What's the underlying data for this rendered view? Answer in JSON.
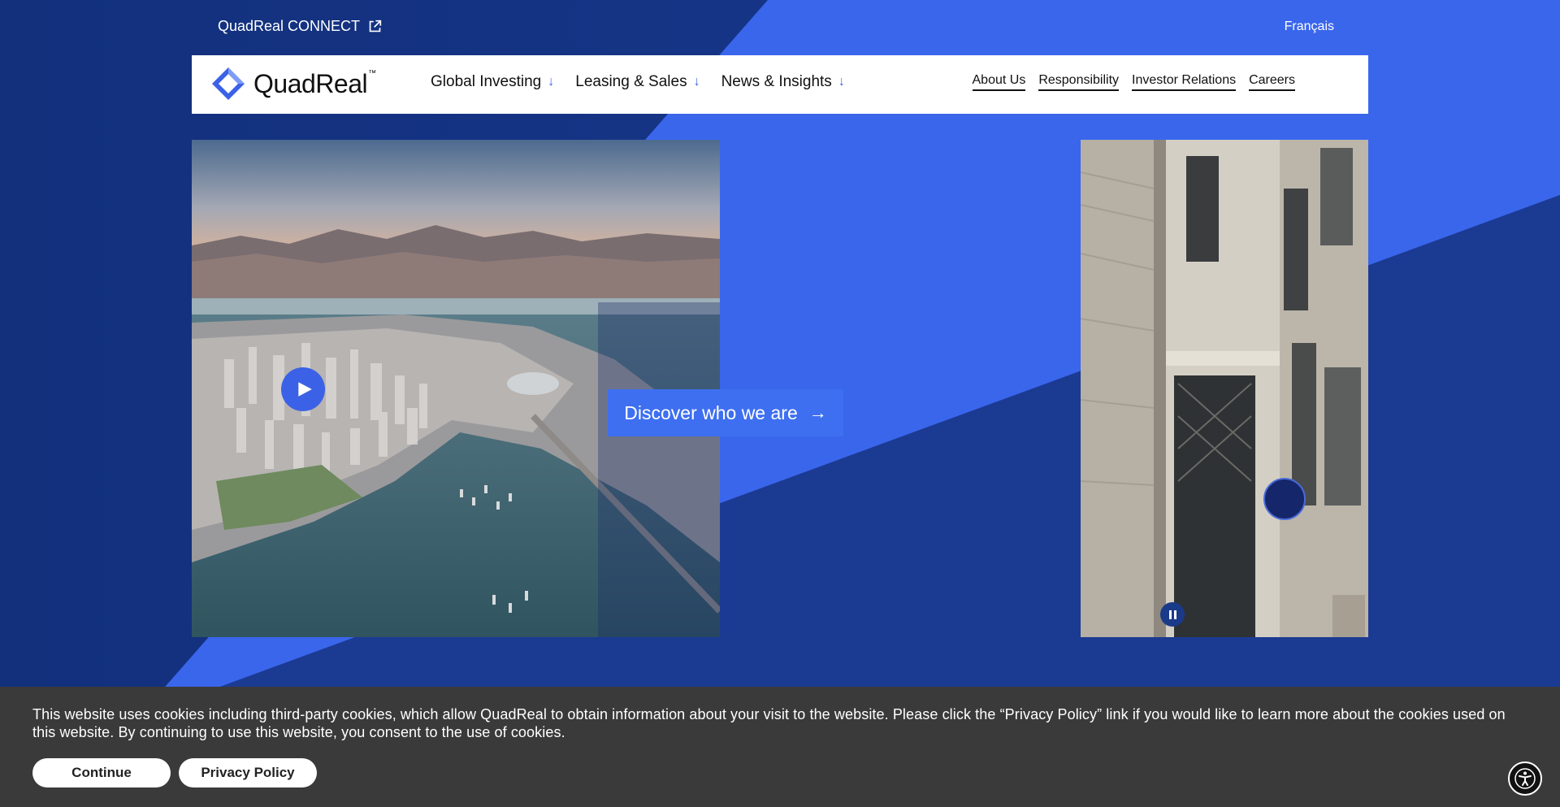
{
  "utility": {
    "connect_label": "QuadReal CONNECT",
    "language_label": "Français"
  },
  "logo": {
    "text": "QuadReal",
    "tm": "™"
  },
  "nav": {
    "main": [
      {
        "label": "Global Investing",
        "icon": "arrow-down-icon"
      },
      {
        "label": "Leasing & Sales",
        "icon": "arrow-down-icon"
      },
      {
        "label": "News & Insights",
        "icon": "arrow-down-icon"
      }
    ],
    "secondary": [
      "About Us",
      "Responsibility",
      "Investor Relations",
      "Careers"
    ]
  },
  "hero": {
    "cta_label": "Discover who we are",
    "cta_icon": "arrow-right-icon"
  },
  "cookie": {
    "text": "This website uses cookies including third-party cookies, which allow QuadReal to obtain information about your visit to the website. Please click the “Privacy Policy” link if you would like to learn more about the cookies used on this website. By continuing to use this website, you consent to the use of cookies.",
    "continue_label": "Continue",
    "privacy_label": "Privacy Policy"
  },
  "colors": {
    "background": "#142f7a",
    "accent": "#3e6ff0",
    "cookie_bg": "#3a3a3a"
  }
}
